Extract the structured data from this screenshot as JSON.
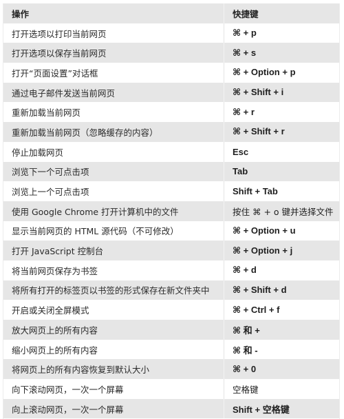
{
  "table": {
    "headers": {
      "action": "操作",
      "shortcut": "快捷键"
    },
    "rows": [
      {
        "action": "打开选项以打印当前网页",
        "shortcut": "⌘ + p"
      },
      {
        "action": "打开选项以保存当前网页",
        "shortcut": "⌘ + s"
      },
      {
        "action": "打开“页面设置”对话框",
        "shortcut": "⌘ + Option + p"
      },
      {
        "action": "通过电子邮件发送当前网页",
        "shortcut": "⌘ + Shift + i"
      },
      {
        "action": "重新加载当前网页",
        "shortcut": "⌘ + r"
      },
      {
        "action": "重新加载当前网页（忽略缓存的内容）",
        "shortcut": "⌘ + Shift + r"
      },
      {
        "action": "停止加载网页",
        "shortcut": "Esc"
      },
      {
        "action": "浏览下一个可点击项",
        "shortcut": "Tab"
      },
      {
        "action": "浏览上一个可点击项",
        "shortcut": "Shift + Tab"
      },
      {
        "action": "使用 Google Chrome 打开计算机中的文件",
        "shortcut": "按住 ⌘ + o 键并选择文件"
      },
      {
        "action": "显示当前网页的 HTML 源代码（不可修改）",
        "shortcut": "⌘ + Option + u"
      },
      {
        "action": "打开 JavaScript 控制台",
        "shortcut": "⌘ + Option + j"
      },
      {
        "action": "将当前网页保存为书签",
        "shortcut": "⌘ + d"
      },
      {
        "action": "将所有打开的标签页以书签的形式保存在新文件夹中",
        "shortcut": "⌘ + Shift + d"
      },
      {
        "action": "开启或关闭全屏模式",
        "shortcut": "⌘ + Ctrl + f"
      },
      {
        "action": "放大网页上的所有内容",
        "shortcut": "⌘ 和 +"
      },
      {
        "action": "缩小网页上的所有内容",
        "shortcut": "⌘ 和 -"
      },
      {
        "action": "将网页上的所有内容恢复到默认大小",
        "shortcut": "⌘ + 0"
      },
      {
        "action": "向下滚动网页，一次一个屏幕",
        "shortcut": "空格键"
      },
      {
        "action": "向上滚动网页，一次一个屏幕",
        "shortcut": "Shift + 空格键"
      }
    ]
  }
}
